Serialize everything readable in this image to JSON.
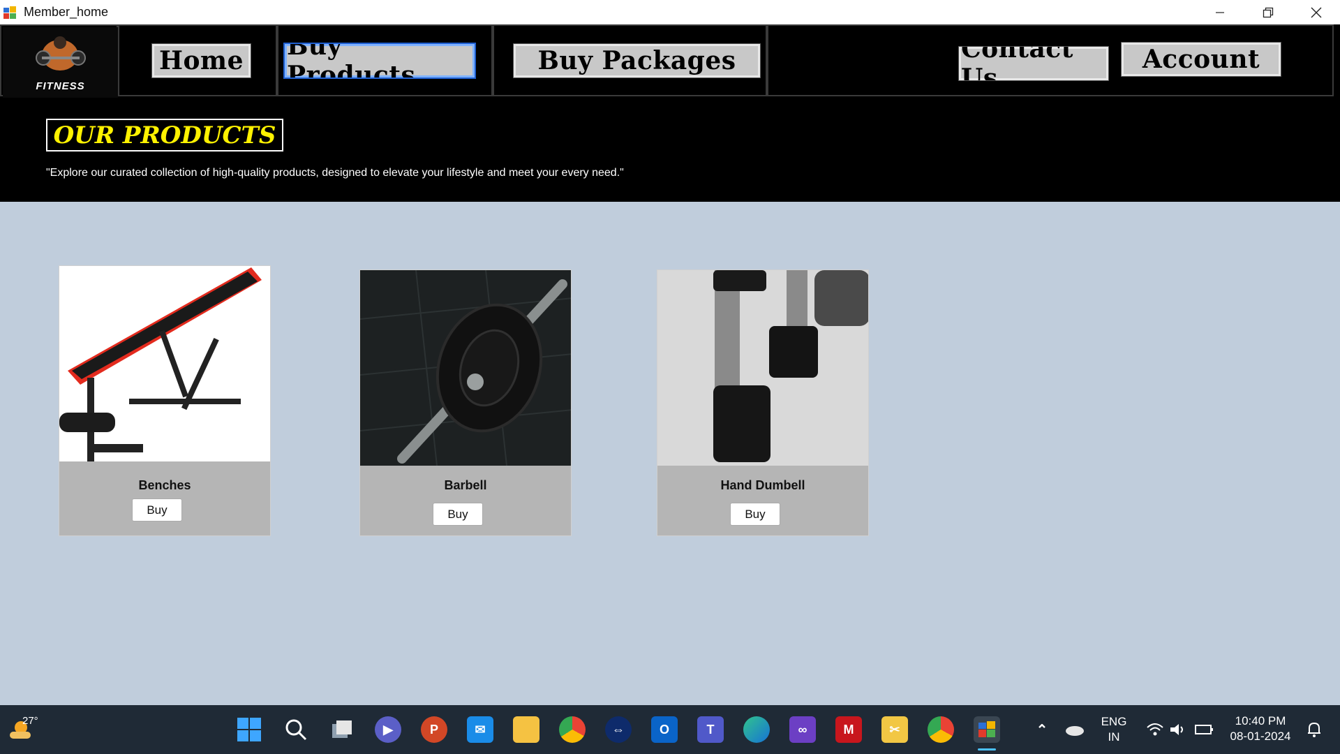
{
  "window": {
    "title": "Member_home",
    "controls": [
      "minimize",
      "restore",
      "close"
    ]
  },
  "nav": {
    "logo_text": "FITNESS",
    "home": "Home",
    "buy_products": "Buy Products",
    "buy_packages": "Buy Packages",
    "contact_us": "Contact Us",
    "account": "Account"
  },
  "hero": {
    "title": "OUR PRODUCTS",
    "tagline": "\"Explore our curated collection of high-quality products, designed to elevate your lifestyle and meet your every need.\""
  },
  "products": [
    {
      "name": "Benches",
      "buy_label": "Buy"
    },
    {
      "name": "Barbell",
      "buy_label": "Buy"
    },
    {
      "name": "Hand Dumbell",
      "buy_label": "Buy"
    }
  ],
  "taskbar": {
    "weather": "27°",
    "language": "ENG",
    "region": "IN",
    "time": "10:40 PM",
    "date": "08-01-2024"
  },
  "colors": {
    "header_bg": "#000000",
    "content_bg": "#c0cddc",
    "title_yellow": "#fff200",
    "card_bg": "#b5b5b5",
    "taskbar_bg": "#1f2a36"
  }
}
